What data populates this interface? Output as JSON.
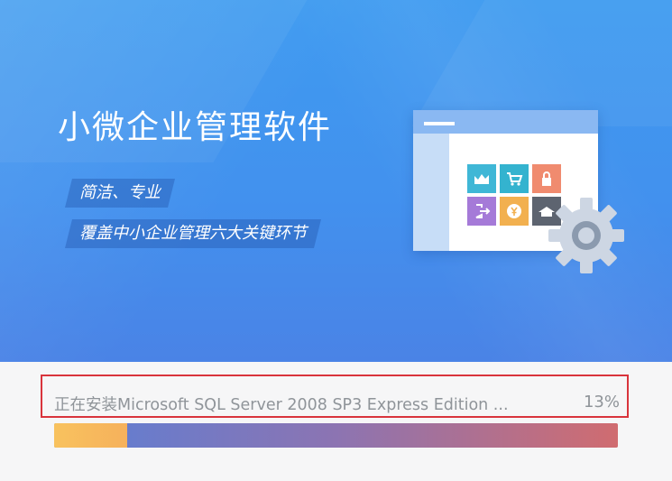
{
  "app": {
    "title": "小微企业管理软件",
    "taglines": [
      "简洁、专业",
      "覆盖中小企业管理六大关键环节"
    ]
  },
  "illustration": {
    "tiles": [
      {
        "icon": "chart-icon",
        "color": "#3fb7d6"
      },
      {
        "icon": "cart-icon",
        "color": "#34b3cf"
      },
      {
        "icon": "lock-icon",
        "color": "#f08b6f"
      },
      {
        "icon": "logout-icon",
        "color": "#a57ad8"
      },
      {
        "icon": "yen-icon",
        "color": "#f2b04f"
      },
      {
        "icon": "warehouse-icon",
        "color": "#5d6470"
      }
    ]
  },
  "install": {
    "status": "正在安装Microsoft SQL Server 2008 SP3 Express Edition ...",
    "percent_label": "13%",
    "progress": 0.13
  },
  "colors": {
    "hero_blue": "#4291ee",
    "highlight_red": "#d9343c",
    "progress_fill": "#f8c25e"
  }
}
